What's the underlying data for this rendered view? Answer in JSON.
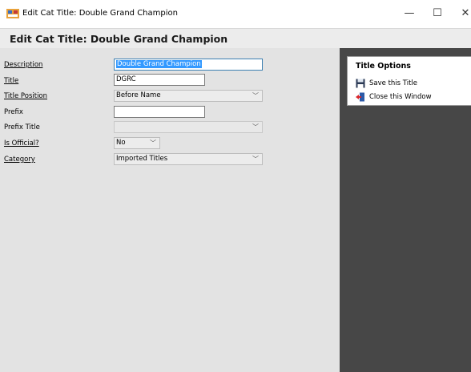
{
  "window": {
    "title": "Edit Cat Title: Double Grand Champion",
    "minimize": "—",
    "maximize": "☐",
    "close": "✕"
  },
  "header": {
    "title": "Edit Cat Title: Double Grand Champion"
  },
  "form": {
    "description_label": "Description",
    "description_value": "Double Grand Champion",
    "title_label": "Title",
    "title_value": "DGRC",
    "title_position_label": "Title Position",
    "title_position_value": "Before Name",
    "prefix_label": "Prefix",
    "prefix_value": "",
    "prefix_title_label": "Prefix Title",
    "prefix_title_value": "",
    "is_official_label": "Is Official?",
    "is_official_value": "No",
    "category_label": "Category",
    "category_value": "Imported Titles"
  },
  "options": {
    "title": "Title Options",
    "save_label": "Save this Title",
    "close_label": "Close this Window"
  },
  "icons": {
    "app": "app-icon",
    "save": "floppy-disk-icon",
    "close": "exit-door-icon"
  },
  "colors": {
    "selection": "#3399ff",
    "sidebar": "#474747",
    "form_background": "#e3e3e3"
  }
}
